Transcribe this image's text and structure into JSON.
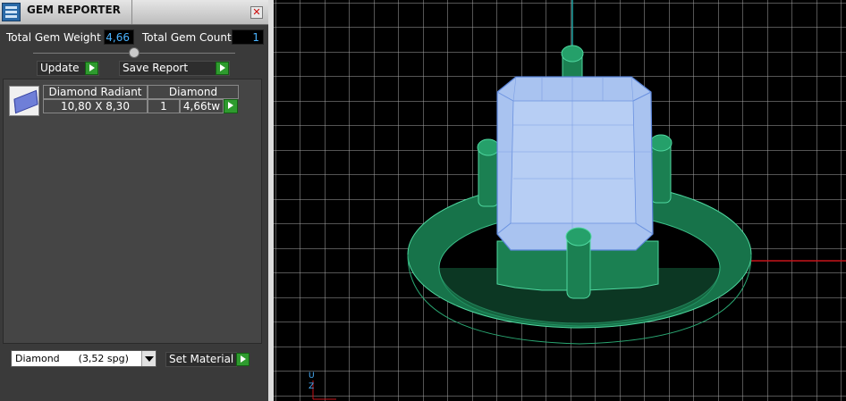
{
  "panel": {
    "title": "GEM REPORTER",
    "total_weight_label": "Total Gem Weight",
    "total_weight_value": "4,66",
    "total_count_label": "Total Gem Count",
    "total_count_value": "1",
    "update_label": "Update",
    "save_report_label": "Save Report"
  },
  "gem_table": {
    "row": {
      "shape": "Diamond Radiant",
      "material": "Diamond",
      "size": "10,80 X 8,30",
      "count": "1",
      "weight": "4,66tw"
    }
  },
  "footer": {
    "material_select_value": "Diamond      (3,52 spg)",
    "set_material_label": "Set Material"
  },
  "viewport": {
    "axis_labels": {
      "top": "U",
      "bottom": "Z"
    }
  },
  "colors": {
    "panel_bg": "#3a3a3a",
    "value_text": "#4ab3ff",
    "arrow_button": "#2e9b2e",
    "metal": "#1e8a5a",
    "gem": "#a9c3f0",
    "grid": "#bdbdbd",
    "axis_x": "#c8141a",
    "axis_y": "#1fa3a3"
  }
}
